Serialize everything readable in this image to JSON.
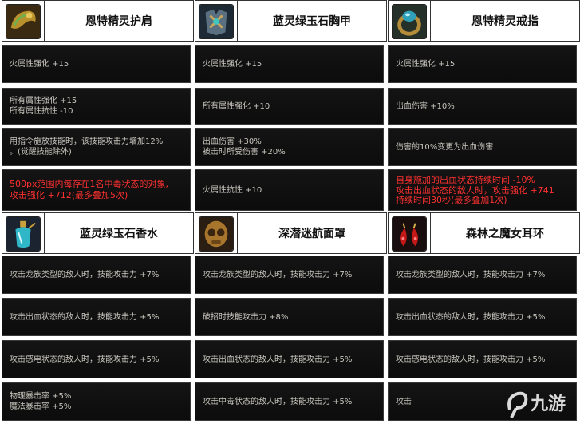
{
  "items": [
    {
      "title": "恩特精灵护肩",
      "icon": "pauldron-icon",
      "stats": [
        [
          "火属性强化 +15"
        ],
        [
          "所有属性强化 +15",
          "所有属性抗性 -10"
        ],
        [
          "用指令施放技能时，该技能攻击力增加12%",
          "。(觉醒技能除外)"
        ],
        [
          "500px范围内每存在1名中毒状态的对象,",
          "攻击强化 +712(最多叠加5次)"
        ]
      ],
      "highlight": [
        false,
        false,
        false,
        true
      ]
    },
    {
      "title": "蓝灵绿玉石胸甲",
      "icon": "chest-armor-icon",
      "stats": [
        [
          "火属性强化 +15"
        ],
        [
          "所有属性强化 +10"
        ],
        [
          "出血伤害 +30%",
          "被击时所受伤害 +20%"
        ],
        [
          "火属性抗性 +10"
        ]
      ],
      "highlight": [
        false,
        false,
        false,
        false
      ]
    },
    {
      "title": "恩特精灵戒指",
      "icon": "ring-icon",
      "stats": [
        [
          "火属性强化 +15"
        ],
        [
          "出血伤害 +10%"
        ],
        [
          "伤害的10%变更为出血伤害"
        ],
        [
          "自身施加的出血状态持续时间 -10%",
          "攻击出血状态的敌人时，攻击强化 +741",
          "持续时间30秒(最多叠加1次)"
        ]
      ],
      "highlight": [
        false,
        false,
        false,
        true
      ]
    },
    {
      "title": "蓝灵绿玉石香水",
      "icon": "perfume-icon",
      "stats": [
        [
          "攻击龙族类型的敌人时，技能攻击力 +7%"
        ],
        [
          "攻击出血状态的敌人时，技能攻击力 +5%"
        ],
        [
          "攻击感电状态的敌人时，技能攻击力 +5%"
        ],
        [
          "物理暴击率 +5%",
          "魔法暴击率 +5%"
        ]
      ],
      "highlight": [
        false,
        false,
        false,
        false
      ]
    },
    {
      "title": "深潜迷航面罩",
      "icon": "mask-icon",
      "stats": [
        [
          "攻击龙族类型的敌人时，技能攻击力 +7%"
        ],
        [
          "破招时技能攻击力 +8%"
        ],
        [
          "攻击出血状态的敌人时，技能攻击力 +5%"
        ],
        [
          "攻击中毒状态的敌人时，技能攻击力 +5%"
        ]
      ],
      "highlight": [
        false,
        false,
        false,
        false
      ]
    },
    {
      "title": "森林之魔女耳环",
      "icon": "earring-icon",
      "stats": [
        [
          "攻击龙族类型的敌人时，技能攻击力 +7%"
        ],
        [
          "攻击出血状态的敌人时，技能攻击力 +5%"
        ],
        [
          "攻击感电状态的敌人时，技能攻击力 +5%"
        ],
        [
          "攻击"
        ]
      ],
      "highlight": [
        false,
        false,
        false,
        false
      ]
    }
  ],
  "watermark": {
    "text": "九游",
    "icon": "nine-game-logo-icon"
  },
  "colors": {
    "cell_text": "#c9c6be",
    "highlight_text": "#ff3030",
    "cell_bg": "#111111"
  }
}
